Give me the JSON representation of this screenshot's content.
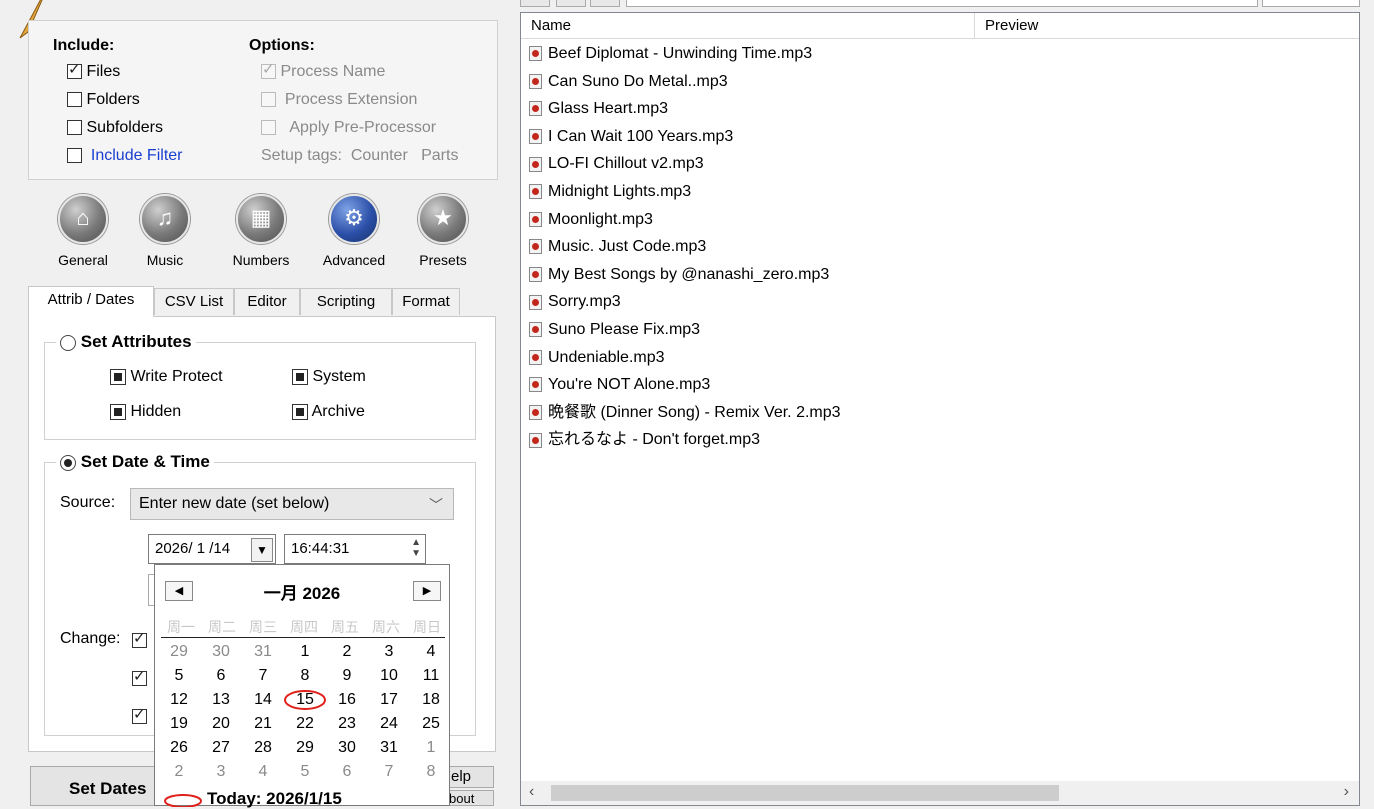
{
  "include": {
    "header": "Include:",
    "files": "Files",
    "folders": "Folders",
    "subfolders": "Subfolders",
    "include_filter": "Include Filter"
  },
  "options": {
    "header": "Options:",
    "process_name": "Process Name",
    "process_extension": "Process Extension",
    "apply_preprocessor": "Apply Pre-Processor",
    "setup_tags_label": "Setup tags:",
    "counter": "Counter",
    "parts": "Parts"
  },
  "toolbar": {
    "general": "General",
    "music": "Music",
    "numbers": "Numbers",
    "advanced": "Advanced",
    "presets": "Presets"
  },
  "tabs": [
    "Attrib / Dates",
    "CSV List",
    "Editor",
    "Scripting",
    "Format"
  ],
  "attributes": {
    "group_label": "Set Attributes",
    "write_protect": "Write Protect",
    "system": "System",
    "hidden": "Hidden",
    "archive": "Archive"
  },
  "datetime": {
    "group_label": "Set Date & Time",
    "source_label": "Source:",
    "source_value": "Enter new date (set below)",
    "date_value": "2026/ 1 /14",
    "time_value": "16:44:31",
    "change_label": "Change:"
  },
  "calendar": {
    "month_label": "一月 2026",
    "today_label": "Today: 2026/1/15",
    "weekdays": [
      "周一",
      "周二",
      "周三",
      "周四",
      "周五",
      "周六",
      "周日"
    ],
    "weeks": [
      [
        "29",
        "30",
        "31",
        "1",
        "2",
        "3",
        "4"
      ],
      [
        "5",
        "6",
        "7",
        "8",
        "9",
        "10",
        "11"
      ],
      [
        "12",
        "13",
        "14",
        "15",
        "16",
        "17",
        "18"
      ],
      [
        "19",
        "20",
        "21",
        "22",
        "23",
        "24",
        "25"
      ],
      [
        "26",
        "27",
        "28",
        "29",
        "30",
        "31",
        "1"
      ],
      [
        "2",
        "3",
        "4",
        "5",
        "6",
        "7",
        "8"
      ]
    ],
    "selected_day": "15"
  },
  "bottom": {
    "set_dates": "Set Dates",
    "help": "elp",
    "about": "bout"
  },
  "list": {
    "col_name": "Name",
    "col_preview": "Preview",
    "files": [
      "Beef Diplomat - Unwinding Time.mp3",
      "Can Suno Do Metal..mp3",
      "Glass Heart.mp3",
      "I Can Wait 100 Years.mp3",
      "LO-FI Chillout v2.mp3",
      "Midnight Lights.mp3",
      "Moonlight.mp3",
      "Music. Just Code.mp3",
      "My Best Songs by @nanashi_zero.mp3",
      "Sorry.mp3",
      "Suno Please Fix.mp3",
      "Undeniable.mp3",
      "You're NOT Alone.mp3",
      "晩餐歌 (Dinner Song) - Remix Ver. 2.mp3",
      "忘れるなよ - Don't forget.mp3"
    ]
  }
}
